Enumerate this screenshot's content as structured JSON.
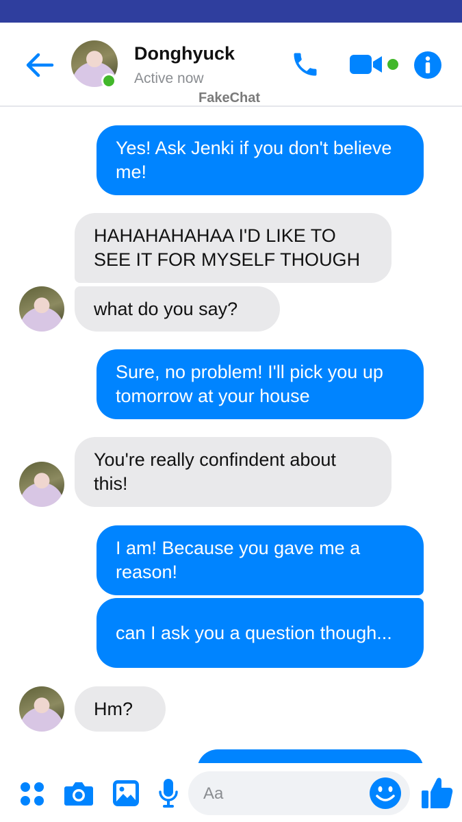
{
  "header": {
    "contact_name": "Donghyuck",
    "status": "Active now",
    "watermark": "FakeChat",
    "icons": [
      "back-arrow-icon",
      "phone-icon",
      "video-camera-icon",
      "info-icon"
    ]
  },
  "messages": [
    {
      "direction": "outgoing",
      "text": "Yes! Ask Jenki if you don't believe me!"
    },
    {
      "direction": "incoming",
      "text": "HAHAHAHAHAA I'D LIKE TO SEE IT FOR MYSELF THOUGH"
    },
    {
      "direction": "incoming",
      "text": "what do you say?"
    },
    {
      "direction": "outgoing",
      "text": "Sure, no problem! I'll pick you up tomorrow at your house"
    },
    {
      "direction": "incoming",
      "text": "You're really confindent about this!"
    },
    {
      "direction": "outgoing",
      "text": "I am! Because you gave me a reason!"
    },
    {
      "direction": "outgoing",
      "text": "can I ask you a question though..."
    },
    {
      "direction": "incoming",
      "text": "Hm?"
    }
  ],
  "composer": {
    "placeholder": "Aa",
    "icons": [
      "apps-icon",
      "camera-icon",
      "gallery-icon",
      "microphone-icon",
      "emoji-icon",
      "thumbs-up-icon"
    ]
  },
  "colors": {
    "status_bar": "#2f3e9e",
    "accent": "#0084ff",
    "incoming_bubble": "#e9e9eb",
    "online": "#42b72a"
  }
}
